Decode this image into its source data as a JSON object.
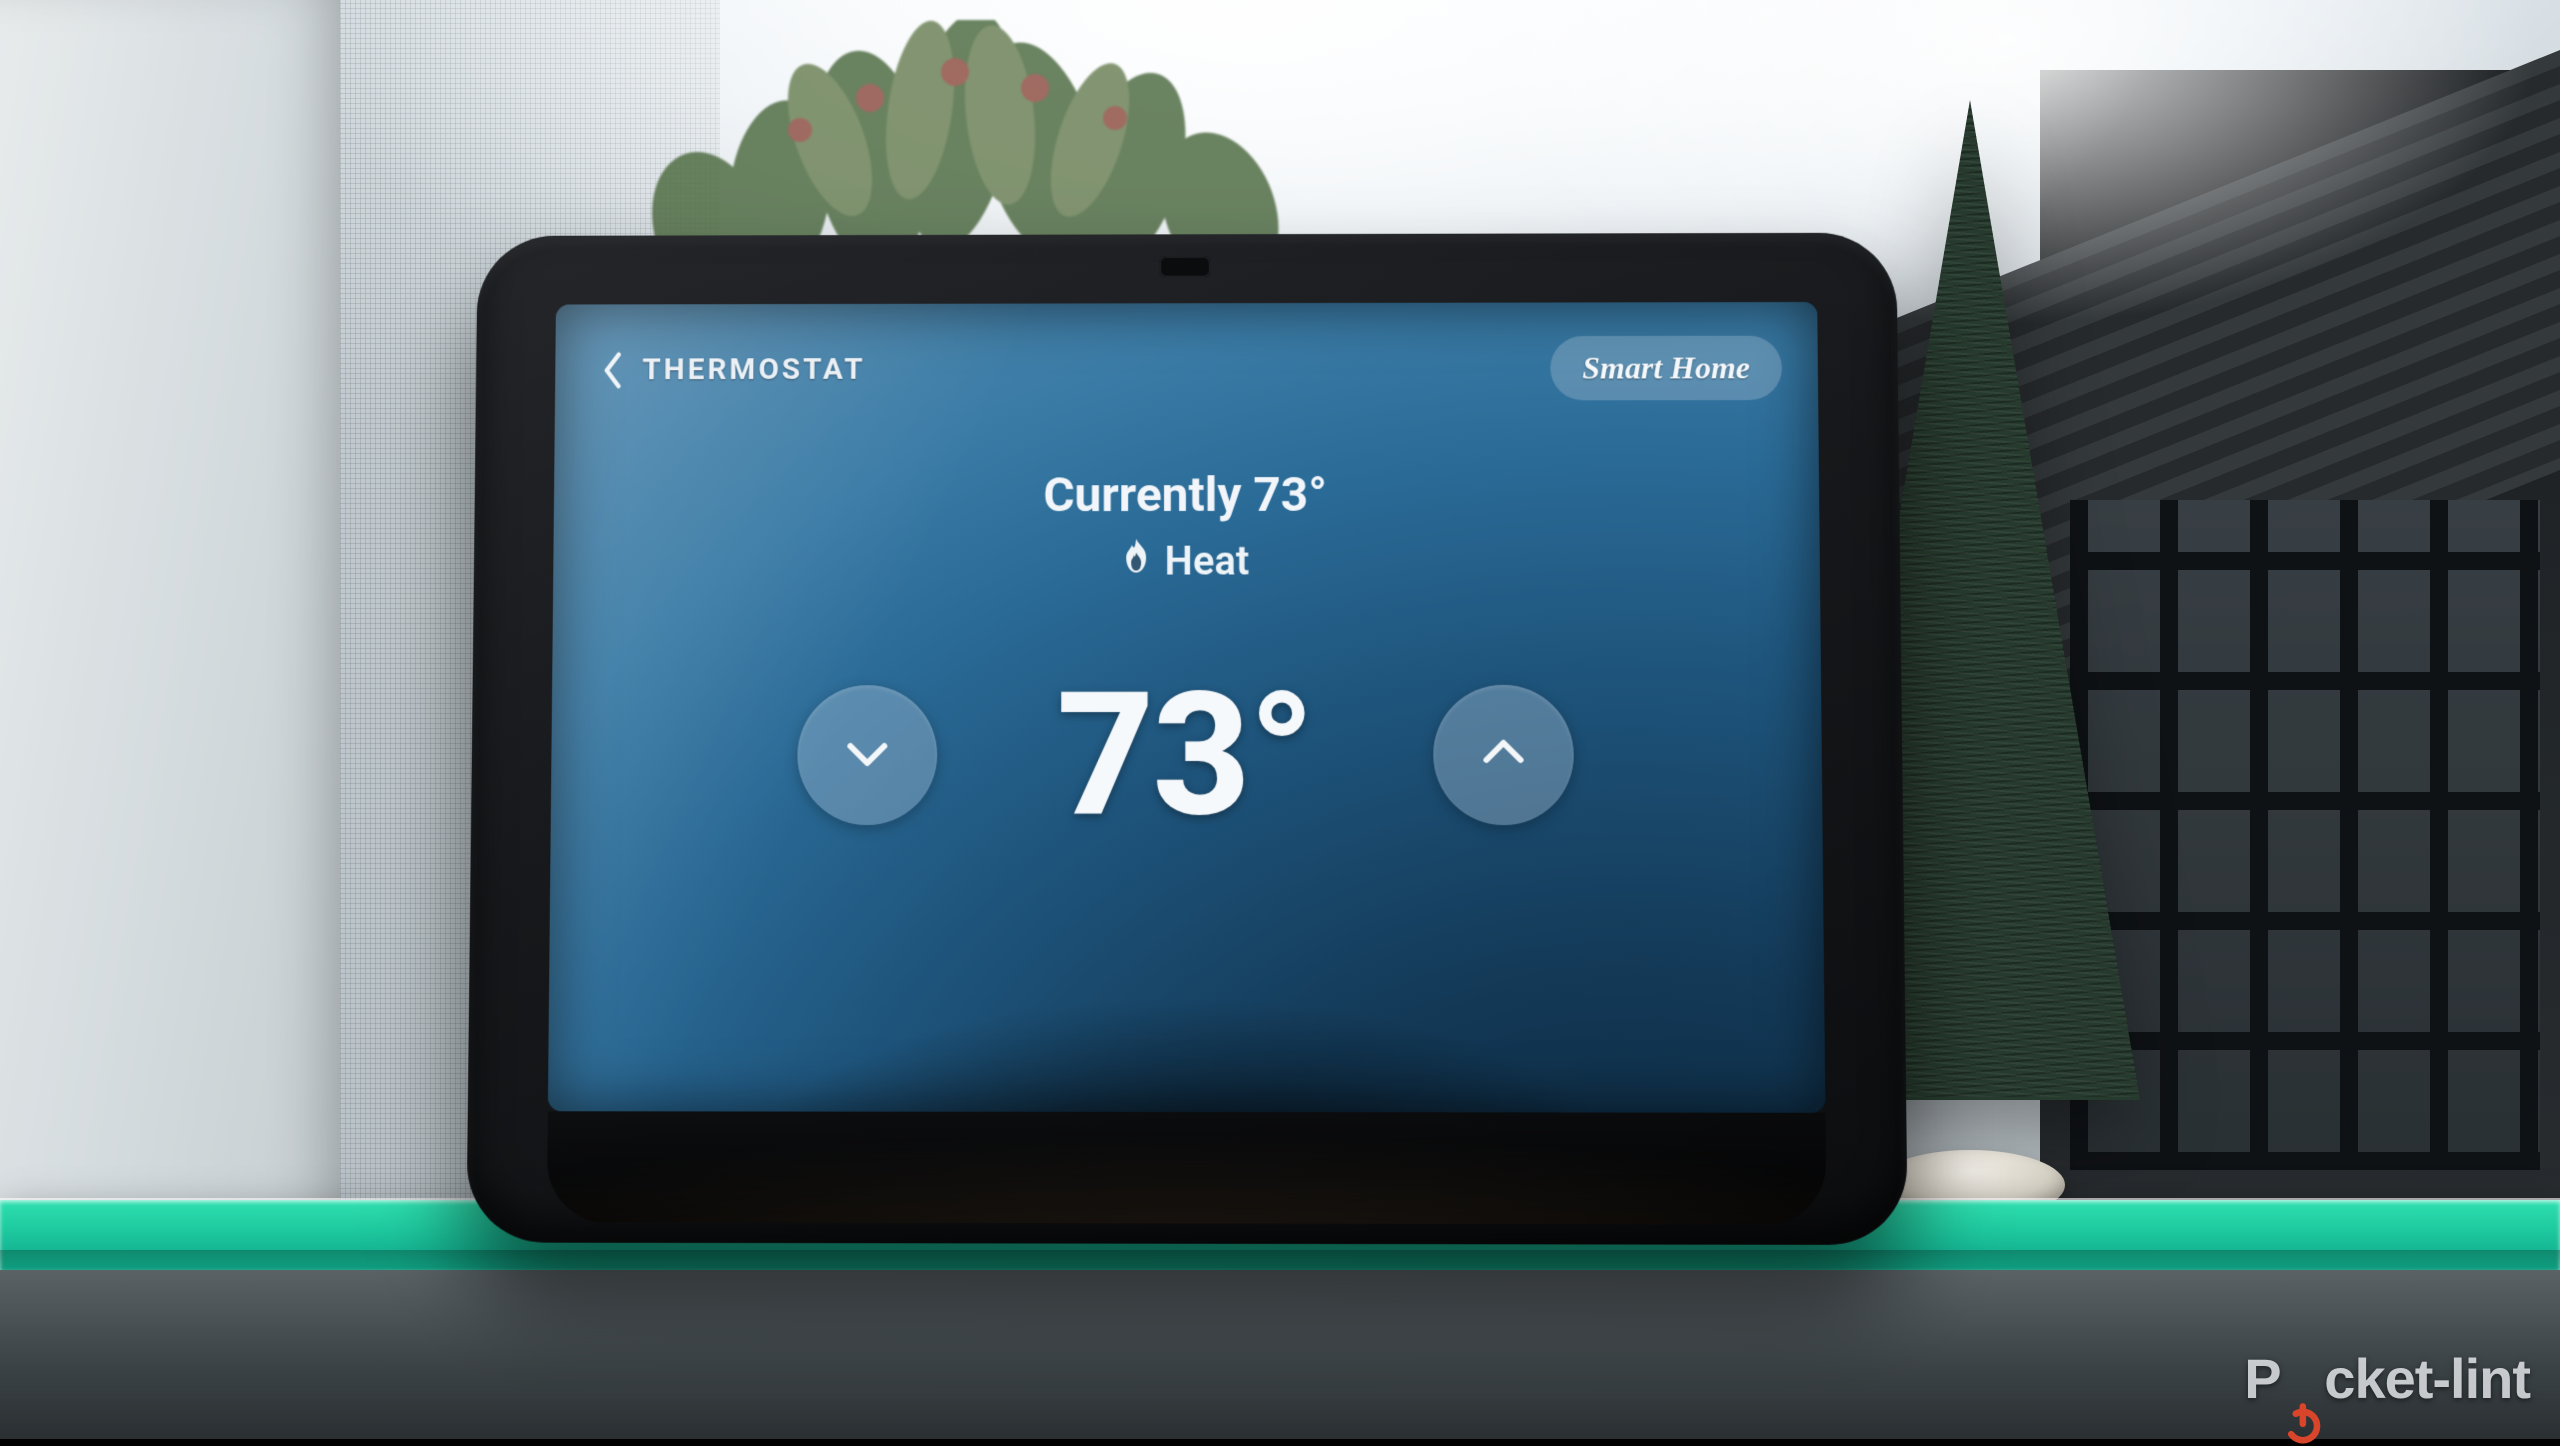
{
  "header": {
    "title": "THERMOSTAT",
    "smart_home_label": "Smart Home"
  },
  "status": {
    "currently_prefix": "Currently ",
    "current_temp": "73°",
    "mode_label": "Heat",
    "mode_icon": "flame-icon"
  },
  "controls": {
    "setpoint": "73°",
    "decrease_icon": "chevron-down-icon",
    "increase_icon": "chevron-up-icon"
  },
  "watermark": {
    "prefix": "P",
    "suffix": "cket-lint"
  },
  "colors": {
    "screen_gradient_dark": "#0a2438",
    "screen_gradient_light": "#5a8eb1",
    "pill_bg": "rgba(180,200,215,0.32)",
    "shelf_green": "#1fcba0",
    "accent_orange": "#d8452a"
  }
}
